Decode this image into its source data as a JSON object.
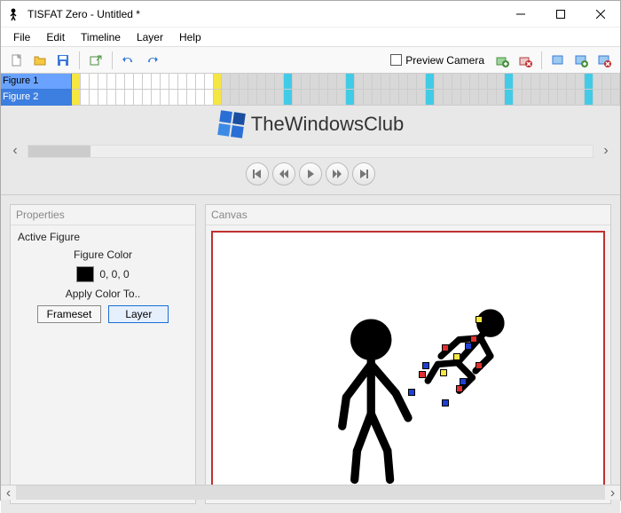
{
  "titlebar": {
    "title": "TISFAT Zero - Untitled *"
  },
  "menu": {
    "file": "File",
    "edit": "Edit",
    "timeline": "Timeline",
    "layer": "Layer",
    "help": "Help"
  },
  "toolbar": {
    "preview_camera": "Preview Camera"
  },
  "timeline": {
    "figures": [
      "Figure 1",
      "Figure 2"
    ]
  },
  "branding": {
    "text": "TheWindowsClub"
  },
  "properties": {
    "panel_title": "Properties",
    "active_figure": "Active Figure",
    "figure_color_label": "Figure Color",
    "color_value": "0, 0, 0",
    "apply_color_label": "Apply Color To..",
    "frameset_btn": "Frameset",
    "layer_btn": "Layer"
  },
  "canvas": {
    "panel_title": "Canvas"
  }
}
